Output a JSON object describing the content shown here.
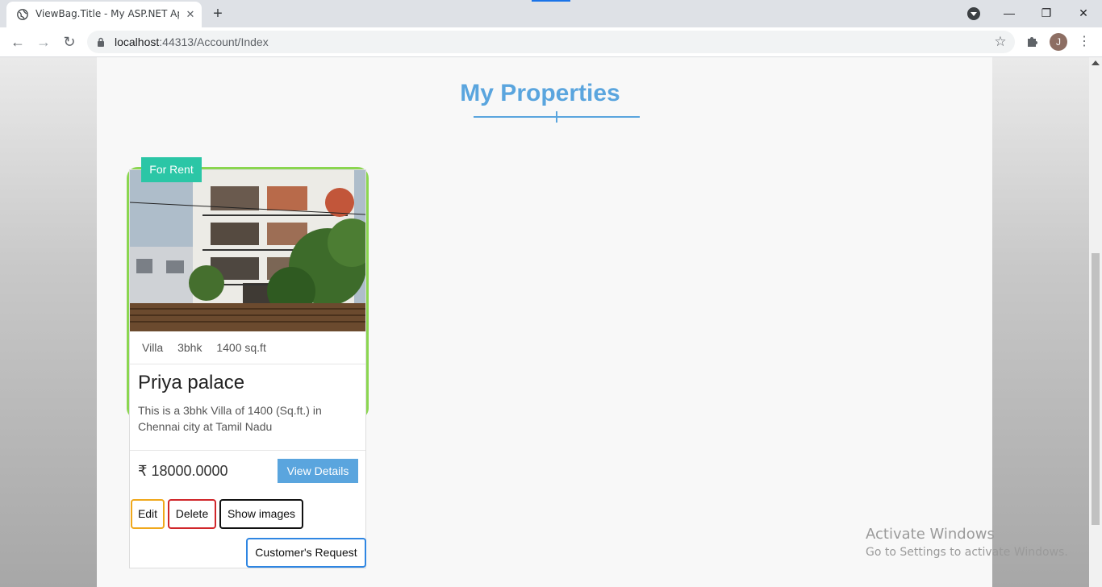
{
  "browser": {
    "tab_title": "ViewBag.Title - My ASP.NET Appl",
    "tab_close": "✕",
    "new_tab": "+",
    "back": "←",
    "forward": "→",
    "reload": "↻",
    "url_host": "localhost",
    "url_rest": ":44313/Account/Index",
    "bookmark_star": "☆",
    "profile_initial": "J",
    "menu": "⋮",
    "minimize": "—",
    "restore": "❐",
    "close": "✕",
    "icons": [
      "globe-icon",
      "lock-icon",
      "star-icon",
      "puzzle-icon",
      "kebab-menu-icon"
    ]
  },
  "page": {
    "title": "My Properties"
  },
  "property": {
    "badge": "For Rent",
    "type": "Villa",
    "rooms": "3bhk",
    "area": "1400 sq.ft",
    "name": "Priya palace",
    "description": "This is a 3bhk Villa of 1400 (Sq.ft.) in Chennai city at Tamil Nadu",
    "price": "₹ 18000.0000",
    "view_label": "View Details",
    "edit_label": "Edit",
    "delete_label": "Delete",
    "images_label": "Show images",
    "request_label": "Customer's Request"
  },
  "watermark": {
    "title": "Activate Windows",
    "subtitle": "Go to Settings to activate Windows."
  },
  "colors": {
    "accent": "#5aa5de",
    "badge": "#2bc6a6",
    "card_outline": "#8bd650",
    "edit": "#f0a81b",
    "delete": "#d0262a",
    "request": "#2f86e2"
  }
}
